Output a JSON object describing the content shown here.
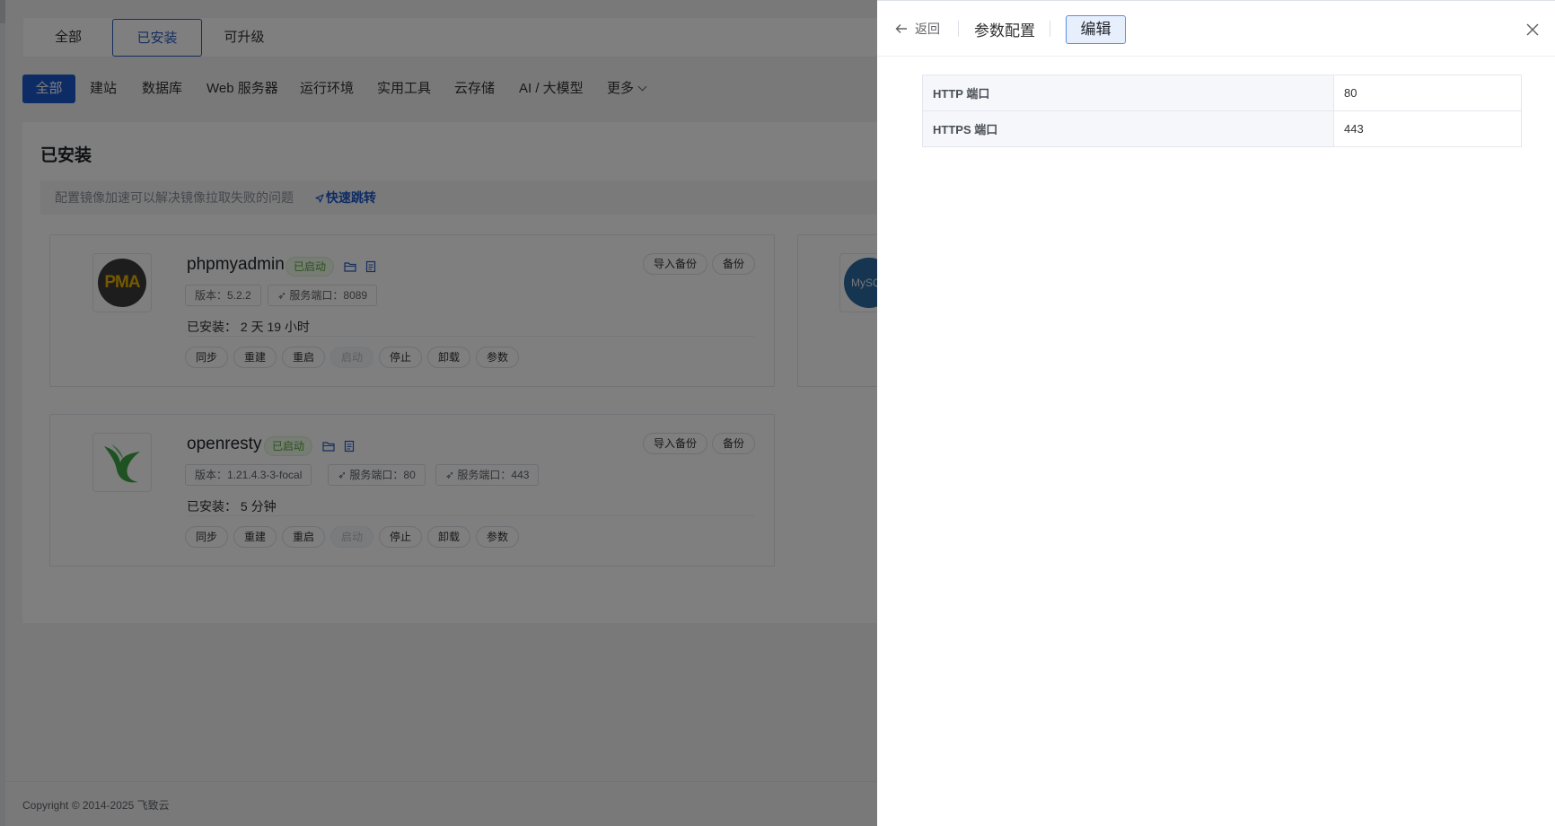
{
  "tabs": [
    {
      "label": "全部"
    },
    {
      "label": "已安装"
    },
    {
      "label": "可升级"
    }
  ],
  "categories": [
    {
      "label": "全部"
    },
    {
      "label": "建站"
    },
    {
      "label": "数据库"
    },
    {
      "label": "Web 服务器"
    },
    {
      "label": "运行环境"
    },
    {
      "label": "实用工具"
    },
    {
      "label": "云存储"
    },
    {
      "label": "AI / 大模型"
    },
    {
      "label": "更多"
    }
  ],
  "panel": {
    "title": "已安装",
    "notice": "配置镜像加速可以解决镜像拉取失败的问题",
    "notice_link": "快速跳转"
  },
  "apps": [
    {
      "name": "phpmyadmin",
      "status": "已启动",
      "logo_text": "PMA",
      "pills": [
        "版本：5.2.2",
        "服务端口：8089"
      ],
      "installed": "已安装： 2 天 19 小时",
      "top_actions": [
        "导入备份",
        "备份"
      ],
      "actions": [
        "同步",
        "重建",
        "重启",
        "启动",
        "停止",
        "卸载",
        "参数"
      ]
    },
    {
      "name": "openresty",
      "status": "已启动",
      "pills": [
        "版本：1.21.4.3-3-focal",
        "服务端口：80",
        "服务端口：443"
      ],
      "installed": "已安装： 5 分钟",
      "top_actions": [
        "导入备份",
        "备份"
      ],
      "actions": [
        "同步",
        "重建",
        "重启",
        "启动",
        "停止",
        "卸载",
        "参数"
      ]
    },
    {
      "logo_text": "MySQL"
    }
  ],
  "footer": "Copyright © 2014-2025 飞致云",
  "drawer": {
    "back_label": "返回",
    "title": "参数配置",
    "edit_label": "编辑",
    "params": [
      {
        "key": "HTTP 端口",
        "value": "80"
      },
      {
        "key": "HTTPS 端口",
        "value": "443"
      }
    ]
  },
  "colors": {
    "accent": "#1a56c8",
    "status_green": "#52a63a",
    "overlay": "rgba(0,0,0,0.5)"
  }
}
